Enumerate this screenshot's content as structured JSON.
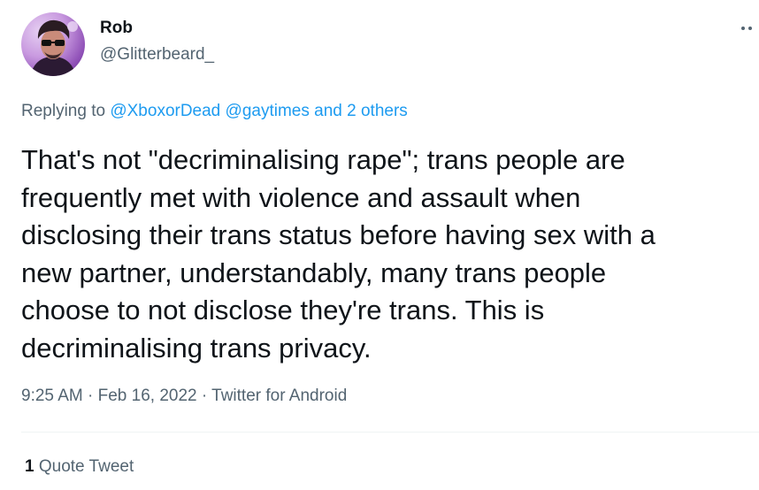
{
  "author": {
    "display_name": "Rob",
    "handle": "@Glitterbeard_",
    "avatar_icon": "profile-photo"
  },
  "reply": {
    "prefix": "Replying to",
    "mention_1": "@XboxorDead",
    "mention_2": "@gaytimes",
    "connector": "and",
    "others": "2 others"
  },
  "tweet": {
    "lines": [
      "That's not \"decriminalising rape\"; trans people are",
      "frequently met with violence and assault when",
      "disclosing their trans status before having sex with a",
      "new partner, understandably, many trans people",
      "choose to not disclose they're trans. This is",
      "decriminalising trans privacy."
    ]
  },
  "meta": {
    "time": "9:25 AM",
    "separator": "·",
    "date": "Feb 16, 2022",
    "source": "Twitter for Android"
  },
  "stats": {
    "quote_count": "1",
    "quote_label": "Quote Tweet"
  },
  "colors": {
    "link": "#1d9bf0",
    "secondary_text": "#536471",
    "primary_text": "#0f1419",
    "divider": "#eff3f4"
  }
}
